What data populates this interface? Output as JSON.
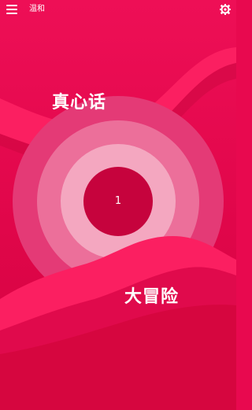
{
  "header": {
    "mode_label": "温和",
    "menu_icon": "hamburger-menu-icon",
    "settings_icon": "settings-gear-icon"
  },
  "main": {
    "truth_label": "真心话",
    "dare_label": "大冒险",
    "counter": "1"
  },
  "colors": {
    "background": "#e8094f",
    "wave": "#fb1f61",
    "ring_outer": "#e43a76",
    "ring_mid": "#ec6f9a",
    "ring_inner": "#f4a7c0",
    "center": "#c6033d",
    "text": "#ffffff"
  }
}
